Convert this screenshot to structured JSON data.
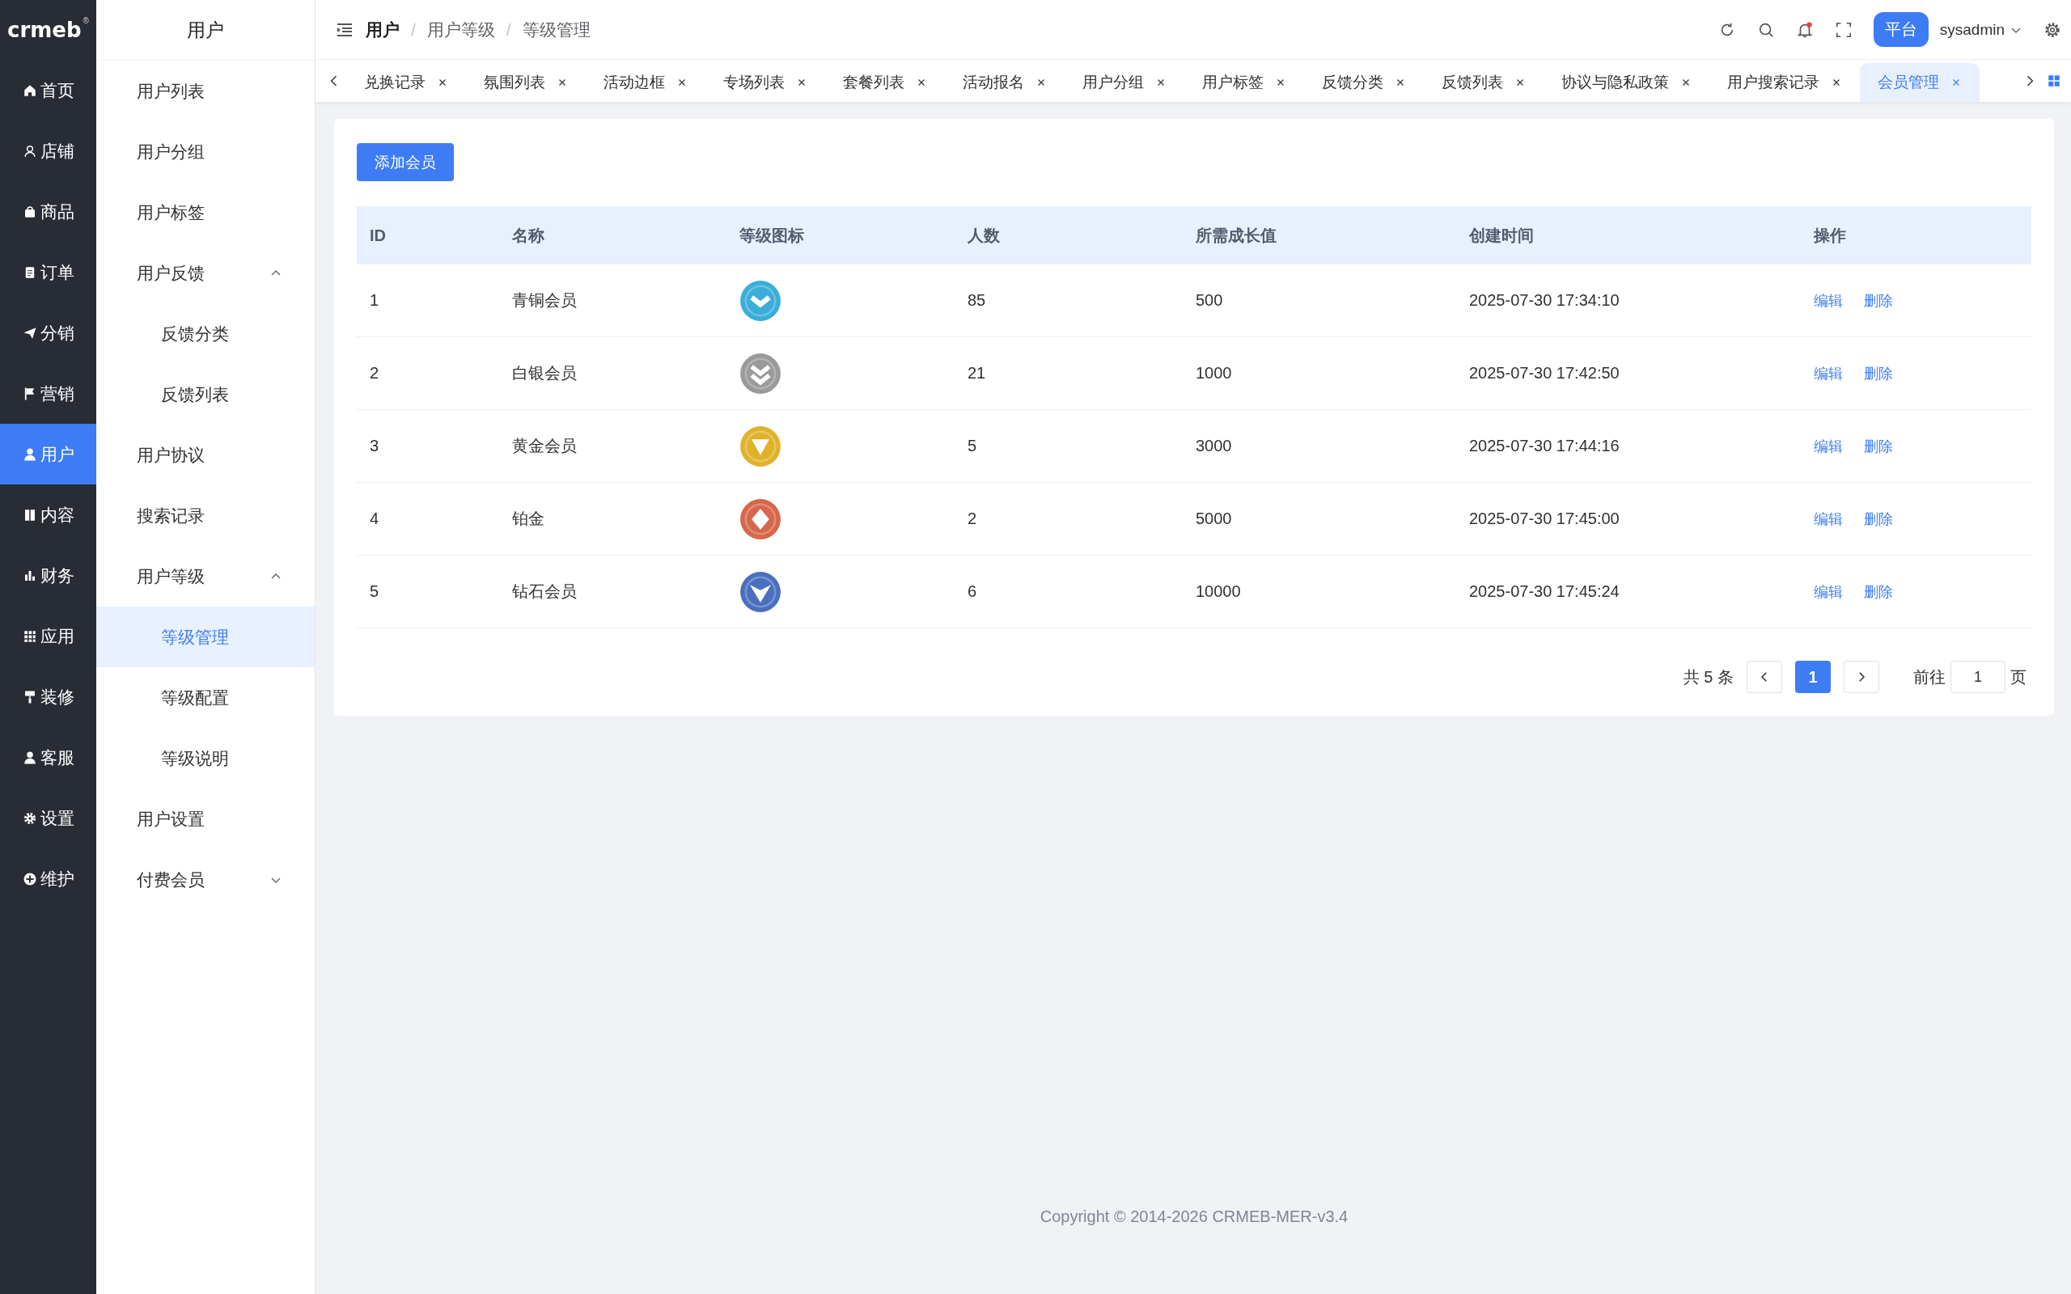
{
  "logo": {
    "text": "crmeb",
    "mark": "®"
  },
  "nav": [
    {
      "label": "首页",
      "selected": false
    },
    {
      "label": "店铺",
      "selected": false
    },
    {
      "label": "商品",
      "selected": false
    },
    {
      "label": "订单",
      "selected": false
    },
    {
      "label": "分销",
      "selected": false
    },
    {
      "label": "营销",
      "selected": false
    },
    {
      "label": "用户",
      "selected": true
    },
    {
      "label": "内容",
      "selected": false
    },
    {
      "label": "财务",
      "selected": false
    },
    {
      "label": "应用",
      "selected": false
    },
    {
      "label": "装修",
      "selected": false
    },
    {
      "label": "客服",
      "selected": false
    },
    {
      "label": "设置",
      "selected": false
    },
    {
      "label": "维护",
      "selected": false
    }
  ],
  "submenu": {
    "title": "用户",
    "items": [
      {
        "label": "用户列表",
        "selected": false
      },
      {
        "label": "用户分组",
        "selected": false
      },
      {
        "label": "用户标签",
        "selected": false
      },
      {
        "label": "用户反馈",
        "selected": false,
        "expanded": true,
        "children": [
          {
            "label": "反馈分类",
            "selected": false
          },
          {
            "label": "反馈列表",
            "selected": false
          }
        ]
      },
      {
        "label": "用户协议",
        "selected": false
      },
      {
        "label": "搜索记录",
        "selected": false
      },
      {
        "label": "用户等级",
        "selected": false,
        "expanded": true,
        "children": [
          {
            "label": "等级管理",
            "selected": true
          },
          {
            "label": "等级配置",
            "selected": false
          },
          {
            "label": "等级说明",
            "selected": false
          }
        ]
      },
      {
        "label": "用户设置",
        "selected": false
      },
      {
        "label": "付费会员",
        "selected": false,
        "expanded": false
      }
    ]
  },
  "breadcrumb": [
    "用户",
    "用户等级",
    "等级管理"
  ],
  "breadcrumb_separator": "/",
  "header": {
    "unread_notification": true,
    "platform_button": "平台",
    "user": "sysadmin"
  },
  "tabs": [
    {
      "label": "兑换记录",
      "selected": false
    },
    {
      "label": "氛围列表",
      "selected": false
    },
    {
      "label": "活动边框",
      "selected": false
    },
    {
      "label": "专场列表",
      "selected": false
    },
    {
      "label": "套餐列表",
      "selected": false
    },
    {
      "label": "活动报名",
      "selected": false
    },
    {
      "label": "用户分组",
      "selected": false
    },
    {
      "label": "用户标签",
      "selected": false
    },
    {
      "label": "反馈分类",
      "selected": false
    },
    {
      "label": "反馈列表",
      "selected": false
    },
    {
      "label": "协议与隐私政策",
      "selected": false
    },
    {
      "label": "用户搜索记录",
      "selected": false
    },
    {
      "label": "会员管理",
      "selected": true
    }
  ],
  "add_button": "添加会员",
  "table": {
    "columns": [
      "ID",
      "名称",
      "等级图标",
      "人数",
      "所需成长值",
      "创建时间",
      "操作"
    ],
    "rows": [
      {
        "id": "1",
        "name": "青铜会员",
        "color": "#3aaed8",
        "count": "85",
        "growth": "500",
        "created": "2025-07-30 17:34:10",
        "actions": [
          "编辑",
          "删除"
        ]
      },
      {
        "id": "2",
        "name": "白银会员",
        "color": "#9a9a9a",
        "count": "21",
        "growth": "1000",
        "created": "2025-07-30 17:42:50",
        "actions": [
          "编辑",
          "删除"
        ]
      },
      {
        "id": "3",
        "name": "黄金会员",
        "color": "#e0b22c",
        "count": "5",
        "growth": "3000",
        "created": "2025-07-30 17:44:16",
        "actions": [
          "编辑",
          "删除"
        ]
      },
      {
        "id": "4",
        "name": "铂金",
        "color": "#d6674a",
        "count": "2",
        "growth": "5000",
        "created": "2025-07-30 17:45:00",
        "actions": [
          "编辑",
          "删除"
        ]
      },
      {
        "id": "5",
        "name": "钻石会员",
        "color": "#4a6fc0",
        "count": "6",
        "growth": "10000",
        "created": "2025-07-30 17:45:24",
        "actions": [
          "编辑",
          "删除"
        ]
      }
    ]
  },
  "pagination": {
    "total": "共 5 条",
    "pages": [
      {
        "label": "1",
        "selected": true
      }
    ],
    "goto_label": "前往",
    "goto_value": "1",
    "page_suffix": "页"
  },
  "footer": "Copyright © 2014-2026 CRMEB-MER-v3.4"
}
